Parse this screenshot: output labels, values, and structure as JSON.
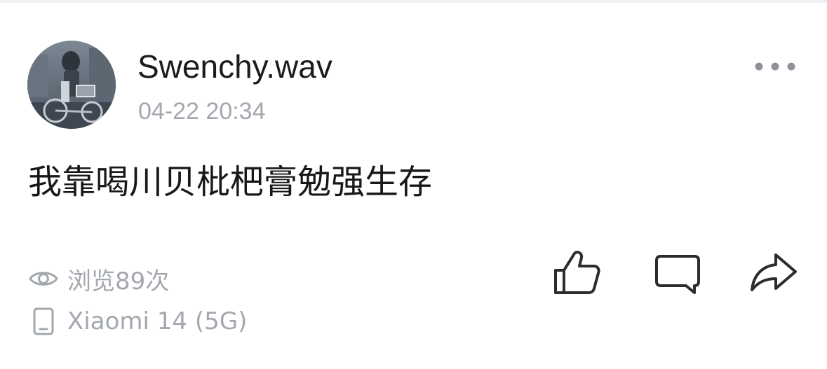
{
  "post": {
    "author": {
      "name": "Swenchy.wav",
      "avatar_icon": "avatar-illustration"
    },
    "timestamp": "04-22 20:34",
    "content": "我靠喝川贝枇杷膏勉强生存",
    "views_label": "浏览89次",
    "device_label": "Xiaomi 14 (5G)"
  },
  "icons": {
    "more": "more-dots-icon",
    "views": "eye-icon",
    "device": "phone-icon",
    "like": "thumbs-up-icon",
    "comment": "comment-icon",
    "share": "share-icon"
  },
  "colors": {
    "text_primary": "#1b1b1f",
    "text_secondary": "#a3a7ae",
    "icon_dark": "#2b2b30",
    "icon_gray": "#8e9299",
    "background": "#ffffff"
  }
}
